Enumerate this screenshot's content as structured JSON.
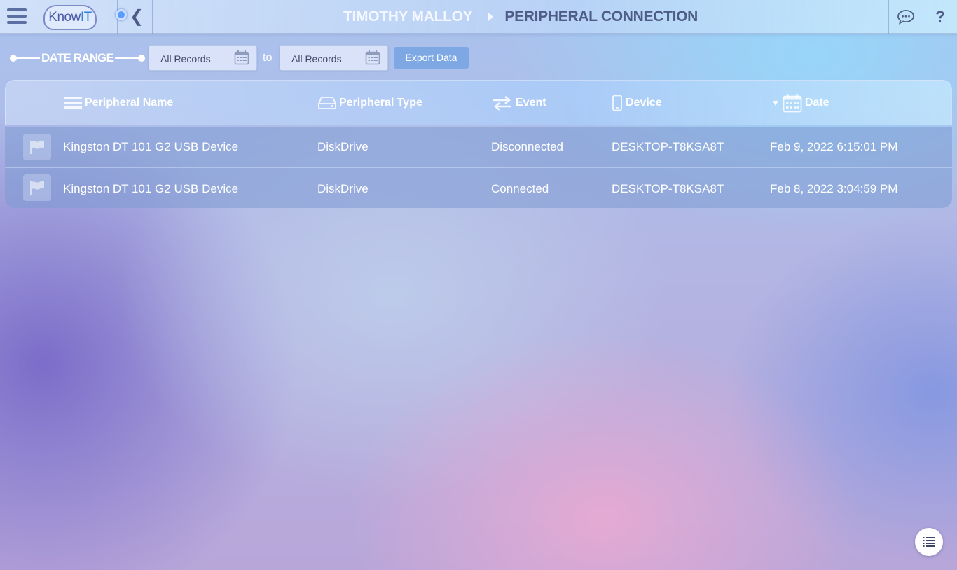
{
  "app": {
    "logo_prefix": "Know",
    "logo_suffix": "IT"
  },
  "header": {
    "user_name": "TIMOTHY MALLOY",
    "page_title": "PERIPHERAL CONNECTION",
    "help_label": "?"
  },
  "filters": {
    "date_range_label": "DATE RANGE",
    "from_value": "All Records",
    "to_label": "to",
    "to_value": "All Records",
    "export_label": "Export Data"
  },
  "table": {
    "columns": [
      "Peripheral Name",
      "Peripheral Type",
      "Event",
      "Device",
      "Date"
    ],
    "sort_indicator": "▼",
    "rows": [
      {
        "name": "Kingston DT 101 G2 USB Device",
        "type": "DiskDrive",
        "event": "Disconnected",
        "device": "DESKTOP-T8KSA8T",
        "date": "Feb 9, 2022 6:15:01 PM"
      },
      {
        "name": "Kingston DT 101 G2 USB Device",
        "type": "DiskDrive",
        "event": "Connected",
        "device": "DESKTOP-T8KSA8T",
        "date": "Feb 8, 2022 3:04:59 PM"
      }
    ]
  },
  "icons": {
    "menu": "hamburger-menu-icon",
    "back": "chevron-left-icon",
    "chat": "chat-bubble-icon",
    "calendar": "calendar-icon",
    "flag": "flag-icon",
    "list": "list-icon"
  },
  "colors": {
    "header_text_dark": "#4f5d86",
    "accent_blue": "#5a9bff",
    "export_button": "#6ea0e1"
  }
}
